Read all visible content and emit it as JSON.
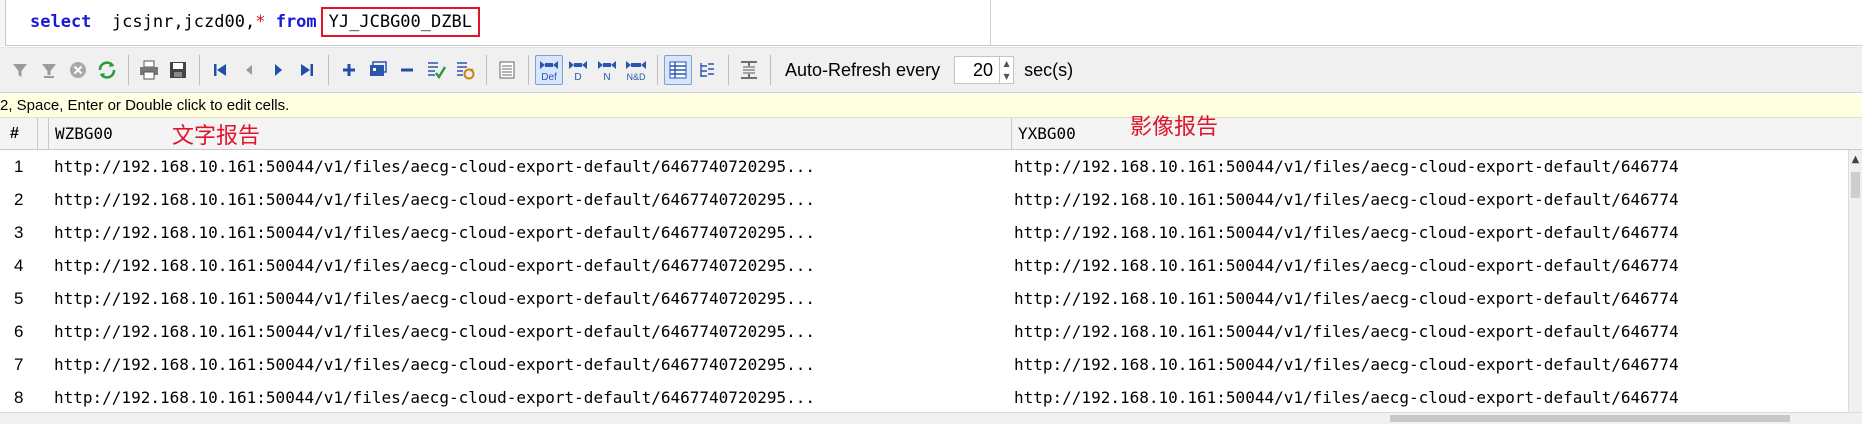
{
  "sql": {
    "keyword_select": "select",
    "columns": "jcsjnr,jczd00,",
    "star": "*",
    "keyword_from": "from",
    "table": "YJ_JCBG00_DZBL"
  },
  "toolbar": {
    "auto_refresh_label": "Auto-Refresh every",
    "interval_value": "20",
    "unit_label": "sec(s)",
    "icons": [
      "filter-icon",
      "clear-filter-icon",
      "cancel-icon",
      "refresh-icon",
      "print-icon",
      "save-icon",
      "first-record-icon",
      "prior-record-icon",
      "next-record-icon",
      "last-record-icon",
      "insert-record-icon",
      "duplicate-record-icon",
      "delete-record-icon",
      "post-icon",
      "refresh-record-icon",
      "form-view-icon",
      "display-default-icon",
      "display-d-icon",
      "display-n-icon",
      "display-nd-icon",
      "grid-view-icon",
      "tree-view-icon",
      "fit-columns-icon"
    ],
    "sort_labels": {
      "def": "Def",
      "d": "D",
      "n": "N",
      "nd": "N&D"
    }
  },
  "hint": "2, Space, Enter or Double click to edit cells.",
  "grid": {
    "headers": {
      "num": "#",
      "col1": "WZBG00",
      "col2": "YXBG00"
    },
    "annotations": {
      "col1": "文字报告",
      "col2": "影像报告"
    },
    "rows": [
      {
        "n": "1",
        "c1": "http://192.168.10.161:50044/v1/files/aecg-cloud-export-default/6467740720295...",
        "c2": "http://192.168.10.161:50044/v1/files/aecg-cloud-export-default/646774"
      },
      {
        "n": "2",
        "c1": "http://192.168.10.161:50044/v1/files/aecg-cloud-export-default/6467740720295...",
        "c2": "http://192.168.10.161:50044/v1/files/aecg-cloud-export-default/646774"
      },
      {
        "n": "3",
        "c1": "http://192.168.10.161:50044/v1/files/aecg-cloud-export-default/6467740720295...",
        "c2": "http://192.168.10.161:50044/v1/files/aecg-cloud-export-default/646774"
      },
      {
        "n": "4",
        "c1": "http://192.168.10.161:50044/v1/files/aecg-cloud-export-default/6467740720295...",
        "c2": "http://192.168.10.161:50044/v1/files/aecg-cloud-export-default/646774"
      },
      {
        "n": "5",
        "c1": "http://192.168.10.161:50044/v1/files/aecg-cloud-export-default/6467740720295...",
        "c2": "http://192.168.10.161:50044/v1/files/aecg-cloud-export-default/646774"
      },
      {
        "n": "6",
        "c1": "http://192.168.10.161:50044/v1/files/aecg-cloud-export-default/6467740720295...",
        "c2": "http://192.168.10.161:50044/v1/files/aecg-cloud-export-default/646774"
      },
      {
        "n": "7",
        "c1": "http://192.168.10.161:50044/v1/files/aecg-cloud-export-default/6467740720295...",
        "c2": "http://192.168.10.161:50044/v1/files/aecg-cloud-export-default/646774"
      },
      {
        "n": "8",
        "c1": "http://192.168.10.161:50044/v1/files/aecg-cloud-export-default/6467740720295...",
        "c2": "http://192.168.10.161:50044/v1/files/aecg-cloud-export-default/646774"
      }
    ]
  },
  "colors": {
    "annotation": "#e0142a",
    "keyword": "#1a1ad8",
    "hint_bg": "#ffffe1"
  }
}
